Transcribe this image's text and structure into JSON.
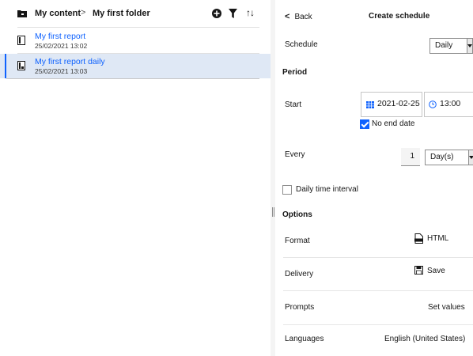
{
  "breadcrumb": {
    "root": "My content",
    "separator": ">",
    "current": "My first folder"
  },
  "toolbar": {
    "icons": [
      "add-icon",
      "filter-icon",
      "sort-icon"
    ],
    "sort_glyph": "↑↓"
  },
  "items": [
    {
      "title": "My first report",
      "date": "25/02/2021 13:02",
      "icon": "report-icon"
    },
    {
      "title": "My first report daily",
      "date": "25/02/2021 13:03",
      "icon": "report-view-icon",
      "selected": true
    }
  ],
  "panel": {
    "back_chevron": "<",
    "back_label": "Back",
    "title": "Create schedule",
    "schedule": {
      "label": "Schedule",
      "value": "Daily"
    },
    "period": {
      "heading": "Period",
      "start_label": "Start",
      "start_date": "2021-02-25",
      "start_time": "13:00",
      "no_end_date_label": "No end date",
      "no_end_date_checked": true
    },
    "every": {
      "label": "Every",
      "value": "1",
      "unit": "Day(s)"
    },
    "daily_interval": {
      "label": "Daily time interval",
      "checked": false
    },
    "options": {
      "heading": "Options",
      "format": {
        "label": "Format",
        "value": "HTML"
      },
      "delivery": {
        "label": "Delivery",
        "value": "Save"
      },
      "prompts": {
        "label": "Prompts",
        "value": "Set values"
      },
      "languages": {
        "label": "Languages",
        "value": "English (United States)"
      }
    }
  },
  "colors": {
    "link": "#0f62fe",
    "selected_row": "#dfe8f5",
    "checkbox": "#0f62fe"
  }
}
